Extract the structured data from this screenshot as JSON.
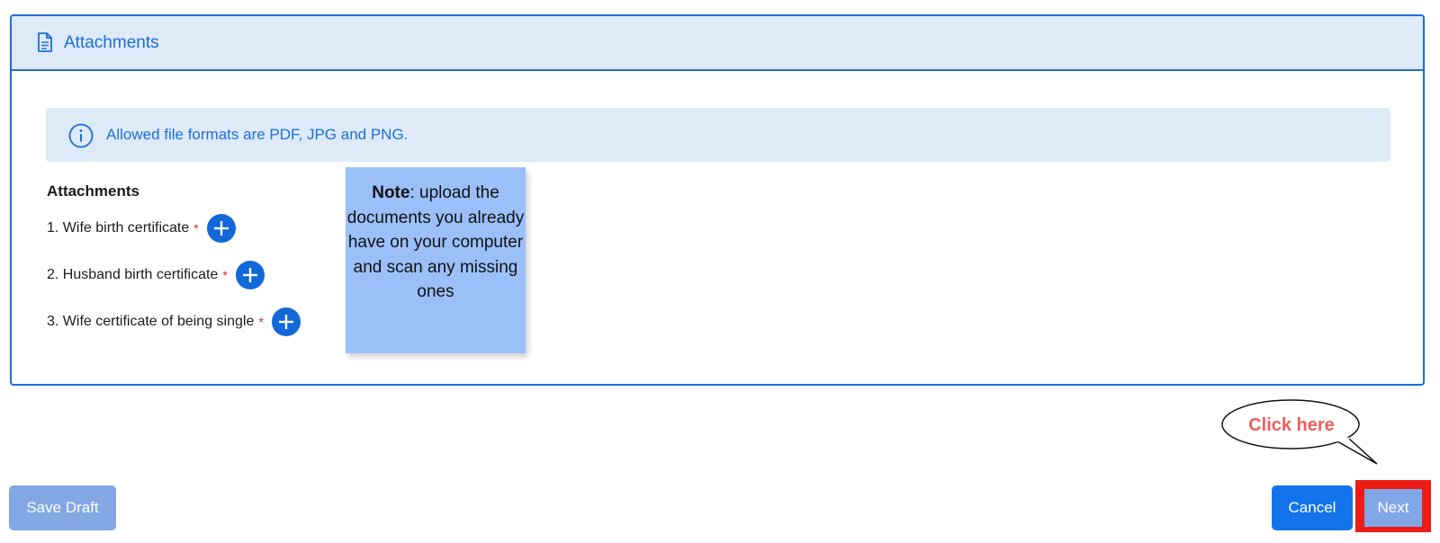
{
  "panel": {
    "title": "Attachments",
    "header_icon": "document-icon"
  },
  "info": {
    "icon": "info-icon",
    "text": "Allowed file formats are PDF, JPG and PNG."
  },
  "attachments": {
    "title": "Attachments",
    "items": [
      {
        "label": "1. Wife birth certificate",
        "required": "*"
      },
      {
        "label": "2. Husband birth certificate",
        "required": "*"
      },
      {
        "label": "3. Wife certificate of being single",
        "required": "*"
      }
    ]
  },
  "note": {
    "bold": "Note",
    "text": ":  upload the documents you already have on your computer and scan any missing ones"
  },
  "footer": {
    "save_label": "Save Draft",
    "cancel_label": "Cancel",
    "next_label": "Next"
  },
  "callout": {
    "text": "Click here"
  },
  "colors": {
    "primary": "#1273eb",
    "header_bg": "#deeaf8",
    "note_bg": "#9bbff9",
    "highlight_red": "#ee1c17",
    "callout_text": "#f05d5d"
  }
}
